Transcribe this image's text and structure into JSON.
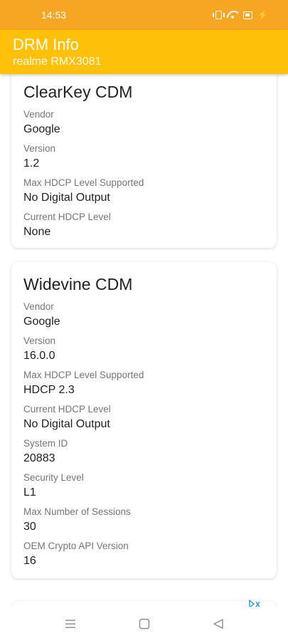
{
  "status_bar": {
    "time": "14:53",
    "icons": [
      "vibrate-icon",
      "wifi-icon",
      "battery-saver-icon",
      "charging-bolt-icon"
    ]
  },
  "app_bar": {
    "title": "DRM Info",
    "subtitle": "realme RMX3081"
  },
  "colors": {
    "status_bar": "#f6a623",
    "app_bar": "#ffc107",
    "label": "#757575",
    "value": "#212121"
  },
  "cards": [
    {
      "title": "ClearKey CDM",
      "fields": [
        {
          "label": "Vendor",
          "value": "Google"
        },
        {
          "label": "Version",
          "value": "1.2"
        },
        {
          "label": "Max HDCP Level Supported",
          "value": "No Digital Output"
        },
        {
          "label": "Current HDCP Level",
          "value": "None"
        }
      ]
    },
    {
      "title": "Widevine CDM",
      "fields": [
        {
          "label": "Vendor",
          "value": "Google"
        },
        {
          "label": "Version",
          "value": "16.0.0"
        },
        {
          "label": "Max HDCP Level Supported",
          "value": "HDCP 2.3"
        },
        {
          "label": "Current HDCP Level",
          "value": "No Digital Output"
        },
        {
          "label": "System ID",
          "value": "20883"
        },
        {
          "label": "Security Level",
          "value": "L1"
        },
        {
          "label": "Max Number of Sessions",
          "value": "30"
        },
        {
          "label": "OEM Crypto API Version",
          "value": "16"
        }
      ]
    }
  ],
  "nav_bar": {
    "buttons": [
      "menu-icon",
      "home-icon",
      "back-icon"
    ]
  }
}
